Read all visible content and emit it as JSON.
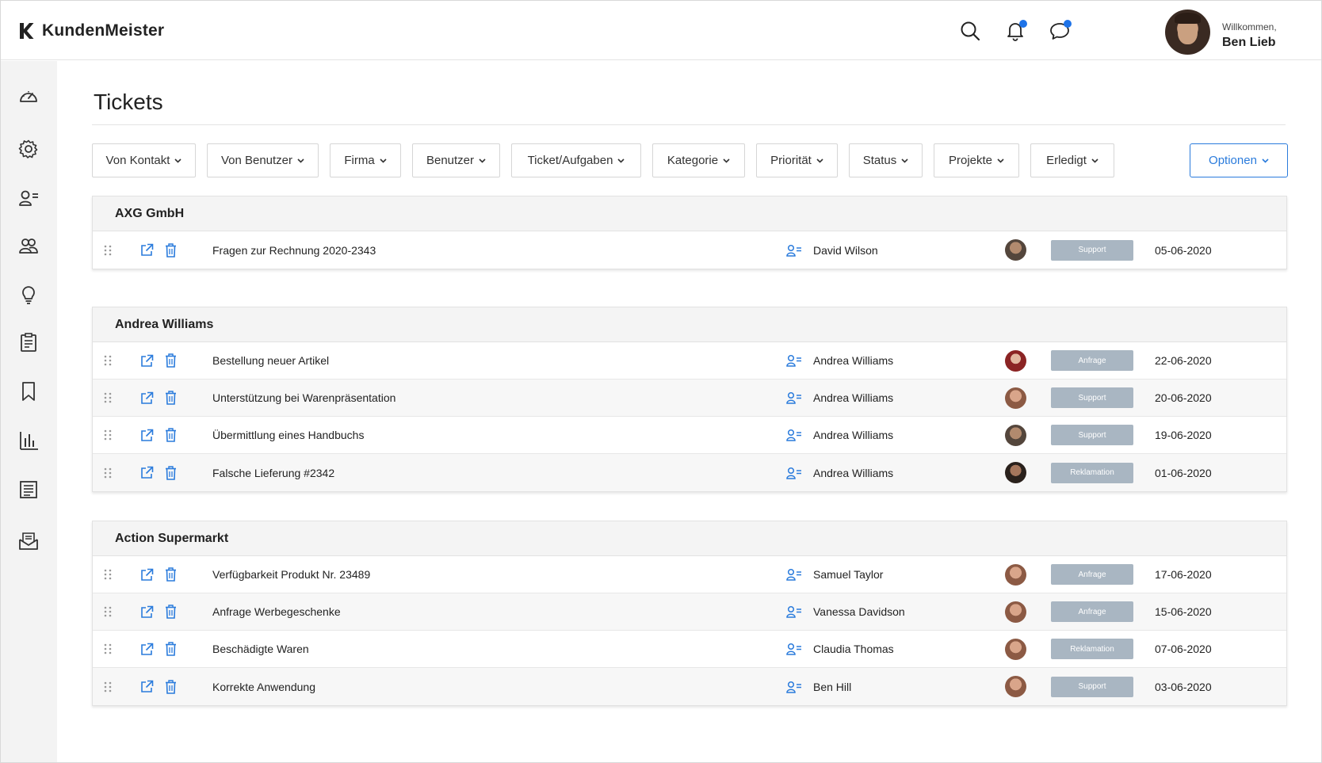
{
  "app": {
    "name": "KundenMeister"
  },
  "header": {
    "welcome_label": "Willkommen,",
    "user_name": "Ben Lieb"
  },
  "page": {
    "title": "Tickets"
  },
  "filters": [
    {
      "label": "Von Kontakt"
    },
    {
      "label": "Von Benutzer"
    },
    {
      "label": "Firma"
    },
    {
      "label": "Benutzer"
    },
    {
      "label": "Ticket/Aufgaben"
    },
    {
      "label": "Kategorie"
    },
    {
      "label": "Priorität"
    },
    {
      "label": "Status"
    },
    {
      "label": "Projekte"
    },
    {
      "label": "Erledigt"
    }
  ],
  "options_label": "Optionen",
  "colors": {
    "accent": "#2a7bdc",
    "badge": "#a9b6c2",
    "notification_dot": "#1e73e8"
  },
  "groups": [
    {
      "name": "AXG GmbH",
      "tickets": [
        {
          "subject": "Fragen zur Rechnung 2020-2343",
          "person": "David Wilson",
          "badge": "Support",
          "date": "05-06-2020"
        }
      ]
    },
    {
      "name": "Andrea Williams",
      "tickets": [
        {
          "subject": "Bestellung neuer Artikel",
          "person": "Andrea Williams",
          "badge": "Anfrage",
          "date": "22-06-2020"
        },
        {
          "subject": "Unterstützung bei Warenpräsentation",
          "person": "Andrea Williams",
          "badge": "Support",
          "date": "20-06-2020"
        },
        {
          "subject": "Übermittlung eines Handbuchs",
          "person": "Andrea Williams",
          "badge": "Support",
          "date": "19-06-2020"
        },
        {
          "subject": "Falsche Lieferung #2342",
          "person": "Andrea Williams",
          "badge": "Reklamation",
          "date": "01-06-2020"
        }
      ]
    },
    {
      "name": "Action Supermarkt",
      "tickets": [
        {
          "subject": "Verfügbarkeit Produkt Nr. 23489",
          "person": "Samuel Taylor",
          "badge": "Anfrage",
          "date": "17-06-2020"
        },
        {
          "subject": "Anfrage Werbegeschenke",
          "person": "Vanessa Davidson",
          "badge": "Anfrage",
          "date": "15-06-2020"
        },
        {
          "subject": "Beschädigte Waren",
          "person": "Claudia Thomas",
          "badge": "Reklamation",
          "date": "07-06-2020"
        },
        {
          "subject": "Korrekte Anwendung",
          "person": "Ben Hill",
          "badge": "Support",
          "date": "03-06-2020"
        }
      ]
    }
  ]
}
